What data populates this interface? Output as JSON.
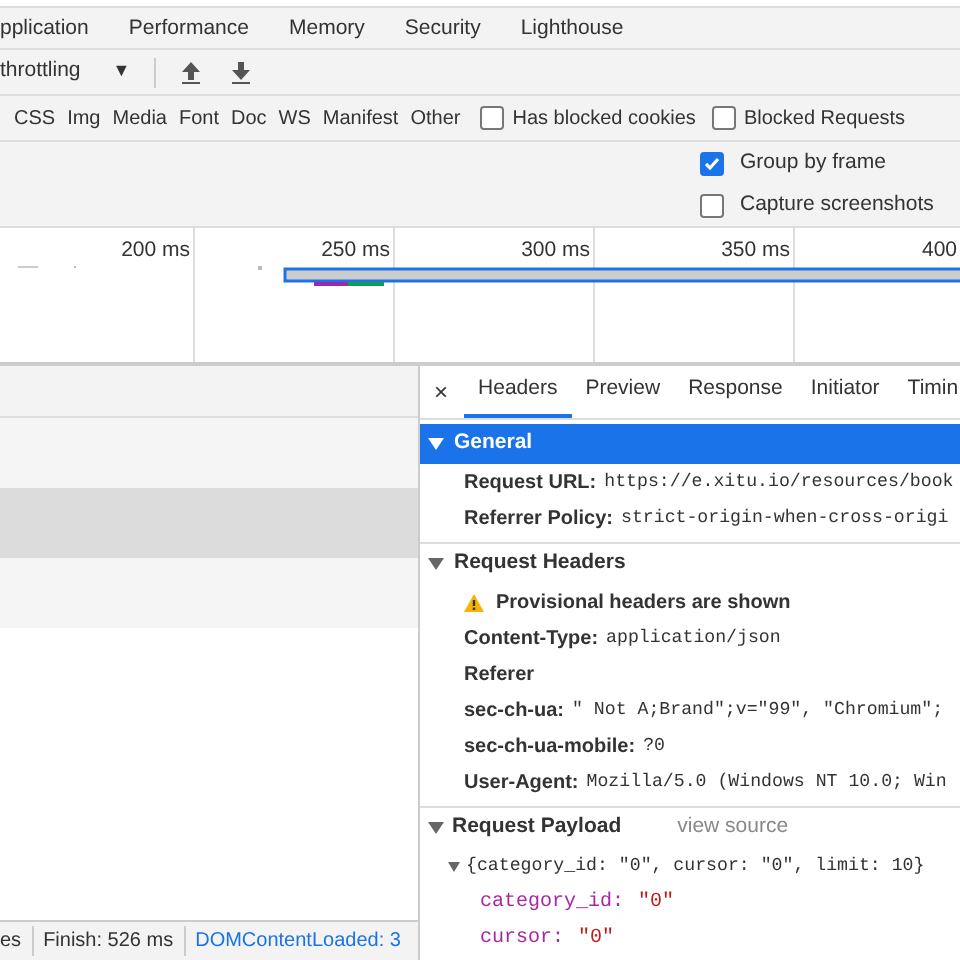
{
  "panel_tabs": [
    {
      "label": "pplication",
      "selected": false
    },
    {
      "label": "Performance",
      "selected": false
    },
    {
      "label": "Memory",
      "selected": false
    },
    {
      "label": "Security",
      "selected": false
    },
    {
      "label": "Lighthouse",
      "selected": false
    }
  ],
  "toolbar": {
    "throttling": "throttling",
    "dropdown_arrow": "▼"
  },
  "filters": {
    "types": [
      "CSS",
      "Img",
      "Media",
      "Font",
      "Doc",
      "WS",
      "Manifest",
      "Other"
    ],
    "checkboxes": [
      {
        "label": "Has blocked cookies",
        "checked": false
      },
      {
        "label": "Blocked Requests",
        "checked": false
      }
    ]
  },
  "options": [
    {
      "label": "Group by frame",
      "checked": true
    },
    {
      "label": "Capture screenshots",
      "checked": false
    }
  ],
  "overview": {
    "ticks": [
      "200 ms",
      "250 ms",
      "300 ms",
      "350 ms",
      "400"
    ]
  },
  "requests": {
    "rows": [
      {
        "selected": false
      },
      {
        "selected": true
      },
      {
        "selected": false
      }
    ]
  },
  "status_bar": [
    "es",
    "Finish: 526 ms",
    "DOMContentLoaded: 3"
  ],
  "details": {
    "close": "×",
    "tabs": [
      {
        "label": "Headers",
        "selected": true
      },
      {
        "label": "Preview",
        "selected": false
      },
      {
        "label": "Response",
        "selected": false
      },
      {
        "label": "Initiator",
        "selected": false
      },
      {
        "label": "Timin",
        "selected": false
      }
    ],
    "sections": [
      {
        "title": "General",
        "expanded": true,
        "highlighted": true,
        "items": [
          {
            "kind": "header",
            "name": "Request URL:",
            "value": "https://e.xitu.io/resources/book"
          },
          {
            "kind": "header",
            "name": "Referrer Policy:",
            "value": "strict-origin-when-cross-origi"
          }
        ]
      },
      {
        "title": "Request Headers",
        "expanded": true,
        "highlighted": false,
        "items": [
          {
            "kind": "warning",
            "name": "Provisional headers are shown"
          },
          {
            "kind": "header",
            "name": "Content-Type:",
            "value": "application/json"
          },
          {
            "kind": "header",
            "name": "Referer"
          },
          {
            "kind": "header",
            "name": "sec-ch-ua:",
            "value": "\" Not A;Brand\";v=\"99\", \"Chromium\";"
          },
          {
            "kind": "header",
            "name": "sec-ch-ua-mobile:",
            "value": "?0"
          },
          {
            "kind": "header",
            "name": "User-Agent:",
            "value": "Mozilla/5.0 (Windows NT 10.0; Win"
          }
        ]
      },
      {
        "title": "Request Payload",
        "expanded": true,
        "highlighted": false,
        "link": "view source",
        "tree": {
          "summary": "{category_id: \"0\", cursor: \"0\", limit: 10}",
          "expanded": true,
          "children": [
            {
              "key": "category_id:",
              "value": "\"0\""
            },
            {
              "key": "cursor:",
              "value": "\"0\""
            }
          ]
        }
      }
    ]
  }
}
